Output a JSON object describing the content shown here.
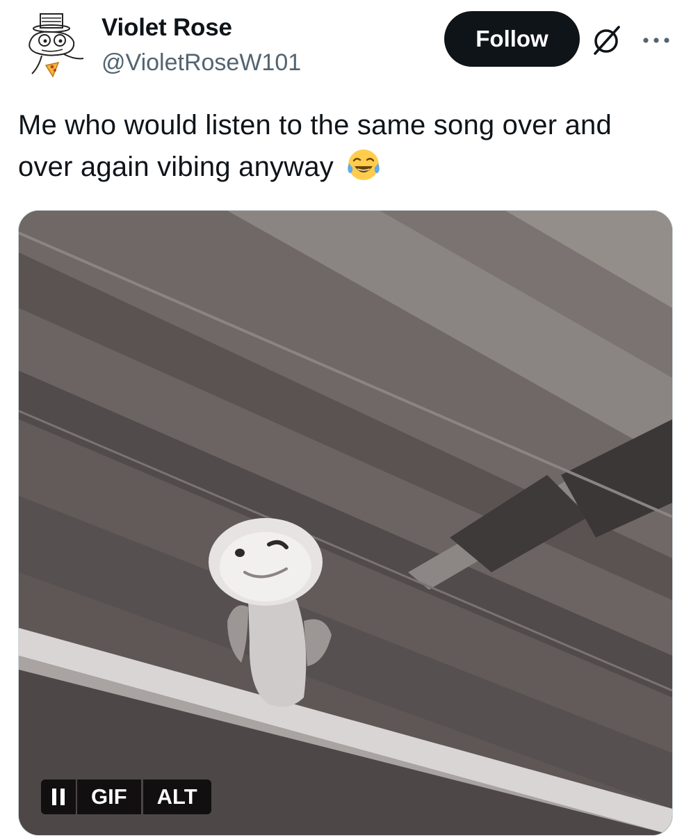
{
  "author": {
    "display_name": "Violet Rose",
    "handle": "@VioletRoseW101",
    "avatar_icon": "frog-top-hat-avatar"
  },
  "actions": {
    "follow_label": "Follow",
    "grok_icon": "grok-icon",
    "more_icon": "more-icon"
  },
  "tweet": {
    "text": "Me who would listen to the same song over and over again vibing anyway",
    "emoji": "face-with-tears-of-joy"
  },
  "media": {
    "type": "gif",
    "pause_icon": "pause-icon",
    "gif_label": "GIF",
    "alt_label": "ALT"
  },
  "colors": {
    "text_primary": "#0f1419",
    "text_secondary": "#536471",
    "button_bg": "#0f1419",
    "border": "#cfd9de"
  }
}
